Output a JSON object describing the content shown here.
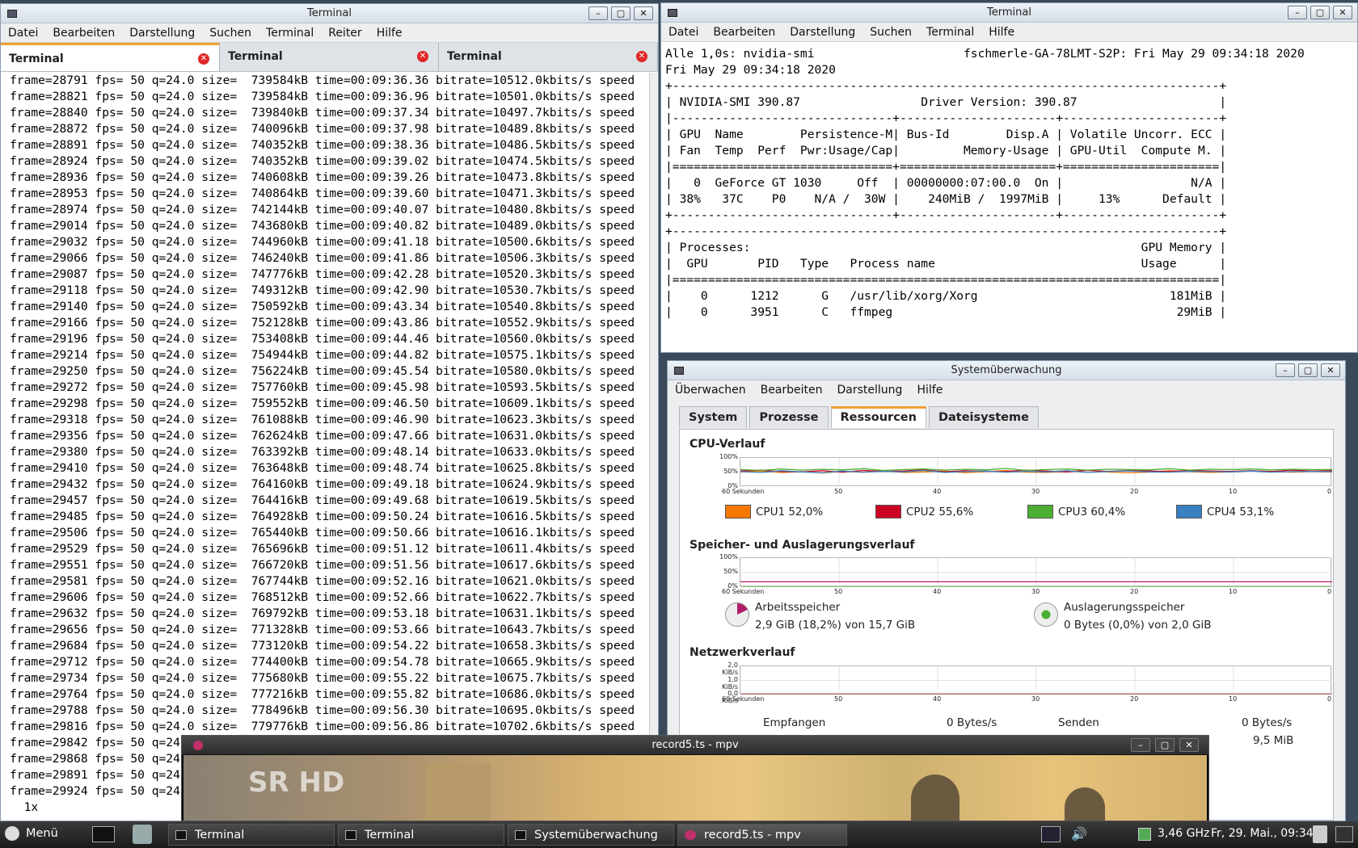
{
  "term1": {
    "title": "Terminal",
    "menu": [
      "Datei",
      "Bearbeiten",
      "Darstellung",
      "Suchen",
      "Terminal",
      "Reiter",
      "Hilfe"
    ],
    "tabs": [
      "Terminal",
      "Terminal",
      "Terminal"
    ],
    "lines": [
      "frame=28791 fps= 50 q=24.0 size=  739584kB time=00:09:36.36 bitrate=10512.0kbits/s speed",
      "frame=28821 fps= 50 q=24.0 size=  739584kB time=00:09:36.96 bitrate=10501.0kbits/s speed",
      "frame=28840 fps= 50 q=24.0 size=  739840kB time=00:09:37.34 bitrate=10497.7kbits/s speed",
      "frame=28872 fps= 50 q=24.0 size=  740096kB time=00:09:37.98 bitrate=10489.8kbits/s speed",
      "frame=28891 fps= 50 q=24.0 size=  740352kB time=00:09:38.36 bitrate=10486.5kbits/s speed",
      "frame=28924 fps= 50 q=24.0 size=  740352kB time=00:09:39.02 bitrate=10474.5kbits/s speed",
      "frame=28936 fps= 50 q=24.0 size=  740608kB time=00:09:39.26 bitrate=10473.8kbits/s speed",
      "frame=28953 fps= 50 q=24.0 size=  740864kB time=00:09:39.60 bitrate=10471.3kbits/s speed",
      "frame=28974 fps= 50 q=24.0 size=  742144kB time=00:09:40.07 bitrate=10480.8kbits/s speed",
      "frame=29014 fps= 50 q=24.0 size=  743680kB time=00:09:40.82 bitrate=10489.0kbits/s speed",
      "frame=29032 fps= 50 q=24.0 size=  744960kB time=00:09:41.18 bitrate=10500.6kbits/s speed",
      "frame=29066 fps= 50 q=24.0 size=  746240kB time=00:09:41.86 bitrate=10506.3kbits/s speed",
      "frame=29087 fps= 50 q=24.0 size=  747776kB time=00:09:42.28 bitrate=10520.3kbits/s speed",
      "frame=29118 fps= 50 q=24.0 size=  749312kB time=00:09:42.90 bitrate=10530.7kbits/s speed",
      "frame=29140 fps= 50 q=24.0 size=  750592kB time=00:09:43.34 bitrate=10540.8kbits/s speed",
      "frame=29166 fps= 50 q=24.0 size=  752128kB time=00:09:43.86 bitrate=10552.9kbits/s speed",
      "frame=29196 fps= 50 q=24.0 size=  753408kB time=00:09:44.46 bitrate=10560.0kbits/s speed",
      "frame=29214 fps= 50 q=24.0 size=  754944kB time=00:09:44.82 bitrate=10575.1kbits/s speed",
      "frame=29250 fps= 50 q=24.0 size=  756224kB time=00:09:45.54 bitrate=10580.0kbits/s speed",
      "frame=29272 fps= 50 q=24.0 size=  757760kB time=00:09:45.98 bitrate=10593.5kbits/s speed",
      "frame=29298 fps= 50 q=24.0 size=  759552kB time=00:09:46.50 bitrate=10609.1kbits/s speed",
      "frame=29318 fps= 50 q=24.0 size=  761088kB time=00:09:46.90 bitrate=10623.3kbits/s speed",
      "frame=29356 fps= 50 q=24.0 size=  762624kB time=00:09:47.66 bitrate=10631.0kbits/s speed",
      "frame=29380 fps= 50 q=24.0 size=  763392kB time=00:09:48.14 bitrate=10633.0kbits/s speed",
      "frame=29410 fps= 50 q=24.0 size=  763648kB time=00:09:48.74 bitrate=10625.8kbits/s speed",
      "frame=29432 fps= 50 q=24.0 size=  764160kB time=00:09:49.18 bitrate=10624.9kbits/s speed",
      "frame=29457 fps= 50 q=24.0 size=  764416kB time=00:09:49.68 bitrate=10619.5kbits/s speed",
      "frame=29485 fps= 50 q=24.0 size=  764928kB time=00:09:50.24 bitrate=10616.5kbits/s speed",
      "frame=29506 fps= 50 q=24.0 size=  765440kB time=00:09:50.66 bitrate=10616.1kbits/s speed",
      "frame=29529 fps= 50 q=24.0 size=  765696kB time=00:09:51.12 bitrate=10611.4kbits/s speed",
      "frame=29551 fps= 50 q=24.0 size=  766720kB time=00:09:51.56 bitrate=10617.6kbits/s speed",
      "frame=29581 fps= 50 q=24.0 size=  767744kB time=00:09:52.16 bitrate=10621.0kbits/s speed",
      "frame=29606 fps= 50 q=24.0 size=  768512kB time=00:09:52.66 bitrate=10622.7kbits/s speed",
      "frame=29632 fps= 50 q=24.0 size=  769792kB time=00:09:53.18 bitrate=10631.1kbits/s speed",
      "frame=29656 fps= 50 q=24.0 size=  771328kB time=00:09:53.66 bitrate=10643.7kbits/s speed",
      "frame=29684 fps= 50 q=24.0 size=  773120kB time=00:09:54.22 bitrate=10658.3kbits/s speed",
      "frame=29712 fps= 50 q=24.0 size=  774400kB time=00:09:54.78 bitrate=10665.9kbits/s speed",
      "frame=29734 fps= 50 q=24.0 size=  775680kB time=00:09:55.22 bitrate=10675.7kbits/s speed",
      "frame=29764 fps= 50 q=24.0 size=  777216kB time=00:09:55.82 bitrate=10686.0kbits/s speed",
      "frame=29788 fps= 50 q=24.0 size=  778496kB time=00:09:56.30 bitrate=10695.0kbits/s speed",
      "frame=29816 fps= 50 q=24.0 size=  779776kB time=00:09:56.86 bitrate=10702.6kbits/s speed",
      "frame=29842 fps= 50 q=24",
      "frame=29868 fps= 50 q=24",
      "frame=29891 fps= 50 q=24",
      "frame=29924 fps= 50 q=24"
    ],
    "prompt": "  1x"
  },
  "term2": {
    "title": "Terminal",
    "menu": [
      "Datei",
      "Bearbeiten",
      "Darstellung",
      "Suchen",
      "Terminal",
      "Hilfe"
    ],
    "lines": [
      "Alle 1,0s: nvidia-smi                     fschmerle-GA-78LMT-S2P: Fri May 29 09:34:18 2020",
      "",
      "Fri May 29 09:34:18 2020",
      "+-----------------------------------------------------------------------------+",
      "| NVIDIA-SMI 390.87                 Driver Version: 390.87                    |",
      "|-------------------------------+----------------------+----------------------+",
      "| GPU  Name        Persistence-M| Bus-Id        Disp.A | Volatile Uncorr. ECC |",
      "| Fan  Temp  Perf  Pwr:Usage/Cap|         Memory-Usage | GPU-Util  Compute M. |",
      "|===============================+======================+======================|",
      "|   0  GeForce GT 1030     Off  | 00000000:07:00.0  On |                  N/A |",
      "| 38%   37C    P0    N/A /  30W |    240MiB /  1997MiB |     13%      Default |",
      "+-------------------------------+----------------------+----------------------+",
      "",
      "+-----------------------------------------------------------------------------+",
      "| Processes:                                                       GPU Memory |",
      "|  GPU       PID   Type   Process name                             Usage      |",
      "|=============================================================================|",
      "|    0      1212      G   /usr/lib/xorg/Xorg                           181MiB |",
      "|    0      3951      C   ffmpeg                                        29MiB |"
    ]
  },
  "sysmon": {
    "title": "Systemüberwachung",
    "menu": [
      "Überwachen",
      "Bearbeiten",
      "Darstellung",
      "Hilfe"
    ],
    "tabs": [
      "System",
      "Prozesse",
      "Ressourcen",
      "Dateisysteme"
    ],
    "cpu_title": "CPU-Verlauf",
    "mem_title": "Speicher- und Auslagerungsverlauf",
    "net_title": "Netzwerkverlauf",
    "x_ticks": [
      "60 Sekunden",
      "50",
      "40",
      "30",
      "20",
      "10",
      "0"
    ],
    "pct_ticks": [
      "100%",
      "50%",
      "0%"
    ],
    "net_ticks": [
      "2,0 KiB/s",
      "1,0 KiB/s",
      "0,0 KiB/s"
    ],
    "cpu_legend": [
      {
        "label": "CPU1 52,0%",
        "color": "#f57900"
      },
      {
        "label": "CPU2 55,6%",
        "color": "#cc0022"
      },
      {
        "label": "CPU3 60,4%",
        "color": "#4caf33"
      },
      {
        "label": "CPU4 53,1%",
        "color": "#3a7fc1"
      }
    ],
    "mem_label": "Arbeitsspeicher",
    "mem_value": "2,9 GiB (18,2%) von 15,7 GiB",
    "swap_label": "Auslagerungsspeicher",
    "swap_value": "0 Bytes (0,0%) von 2,0 GiB",
    "recv_label": "Empfangen",
    "recv_value": "0 Bytes/s",
    "send_label": "Senden",
    "send_value": "0 Bytes/s",
    "send_total": "9,5 MiB"
  },
  "mpv": {
    "title": "record5.ts - mpv",
    "logo": "SR HD"
  },
  "taskbar": {
    "menu_label": "Menü",
    "items": [
      "Terminal",
      "Terminal",
      "Systemüberwachung",
      "record5.ts - mpv"
    ],
    "cpu_freq": "3,46 GHz",
    "clock": "Fr, 29. Mai., 09:34"
  },
  "chart_data": [
    {
      "type": "line",
      "title": "CPU-Verlauf",
      "series": [
        {
          "name": "CPU1 52,0%",
          "values": [
            52,
            55,
            50,
            53,
            48,
            54,
            51,
            56,
            50,
            52,
            55,
            49,
            53,
            57,
            51,
            50,
            54,
            58,
            52,
            49,
            51,
            56,
            53,
            50,
            52,
            55,
            54,
            51,
            53,
            52
          ]
        },
        {
          "name": "CPU2 55,6%",
          "values": [
            55,
            58,
            53,
            52,
            56,
            51,
            57,
            54,
            55,
            59,
            52,
            56,
            54,
            53,
            58,
            55,
            52,
            57,
            54,
            56,
            55,
            53,
            57,
            55,
            54,
            56,
            53,
            58,
            55,
            56
          ]
        },
        {
          "name": "CPU3 60,4%",
          "values": [
            60,
            57,
            62,
            58,
            61,
            59,
            63,
            57,
            60,
            62,
            58,
            61,
            59,
            64,
            57,
            60,
            62,
            58,
            61,
            60,
            59,
            63,
            58,
            61,
            60,
            62,
            59,
            61,
            60,
            60
          ]
        },
        {
          "name": "CPU4 53,1%",
          "values": [
            53,
            50,
            56,
            52,
            49,
            55,
            51,
            54,
            52,
            57,
            50,
            53,
            55,
            51,
            54,
            52,
            56,
            50,
            53,
            55,
            52,
            51,
            54,
            53,
            52,
            55,
            51,
            53,
            54,
            53
          ]
        }
      ],
      "ylim": [
        0,
        100
      ]
    },
    {
      "type": "line",
      "title": "Speicher- und Auslagerungsverlauf",
      "series": [
        {
          "name": "Arbeitsspeicher",
          "values": [
            18.2,
            18.2,
            18.2,
            18.2,
            18.2,
            18.2,
            18.2,
            18.2,
            18.2,
            18.2
          ]
        },
        {
          "name": "Auslagerungsspeicher",
          "values": [
            0,
            0,
            0,
            0,
            0,
            0,
            0,
            0,
            0,
            0
          ]
        }
      ],
      "ylim": [
        0,
        100
      ]
    },
    {
      "type": "line",
      "title": "Netzwerkverlauf",
      "series": [
        {
          "name": "Empfangen",
          "values": [
            0,
            0,
            0,
            0,
            0,
            0,
            0,
            0,
            0,
            0
          ]
        },
        {
          "name": "Senden",
          "values": [
            0,
            0,
            0,
            0,
            0,
            0,
            0,
            0,
            0,
            0
          ]
        }
      ]
    }
  ]
}
